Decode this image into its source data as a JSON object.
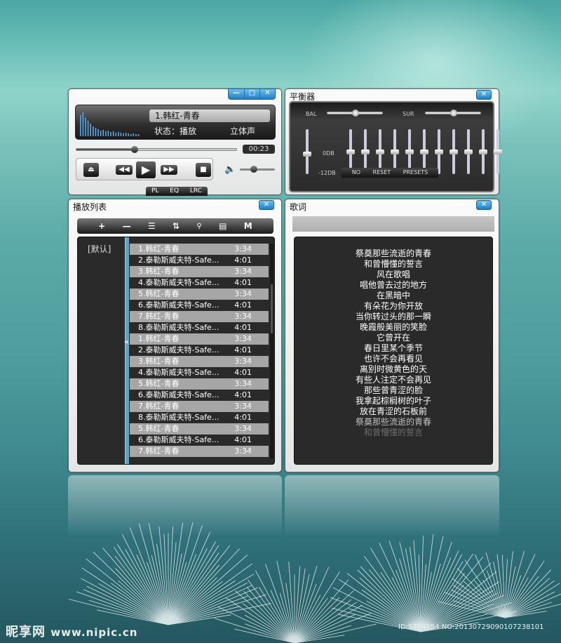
{
  "player": {
    "track": "1.韩红-青春",
    "status_label": "状态：",
    "status_value": "播放",
    "mode": "立体声",
    "time": "00:23",
    "progress": 0.36,
    "volume": 0.4,
    "tabs": [
      "PL",
      "EQ",
      "LRC"
    ],
    "window_buttons": [
      "—",
      "□",
      "✕"
    ]
  },
  "equalizer": {
    "title": "平衡器",
    "bal_label": "BAL",
    "sur_label": "SUR",
    "db_top": "0DB",
    "db_bottom": "-12DB",
    "bands": [
      0.5,
      0.5,
      0.5,
      0.5,
      0.5,
      0.5,
      0.5,
      0.5,
      0.5,
      0.5,
      0.5
    ],
    "preamp": 0.55,
    "buttons": [
      "NO",
      "RESET",
      "PRESETS"
    ]
  },
  "playlist": {
    "title": "播放列表",
    "category": "[默认]",
    "toolbar": [
      "+",
      "—",
      "☰",
      "⇅",
      "🔍",
      "▤",
      "M"
    ],
    "rows": [
      {
        "name": "1.韩红-青春",
        "dur": "3:34"
      },
      {
        "name": "2.泰勒斯威夫特-Safe...",
        "dur": "4:01"
      },
      {
        "name": "3.韩红-青春",
        "dur": "3:34"
      },
      {
        "name": "4.泰勒斯威夫特-Safe...",
        "dur": "4:01"
      },
      {
        "name": "5.韩红-青春",
        "dur": "3:34"
      },
      {
        "name": "6.泰勒斯威夫特-Safe...",
        "dur": "4:01"
      },
      {
        "name": "7.韩红-青春",
        "dur": "3:34"
      },
      {
        "name": "8.泰勒斯威夫特-Safe...",
        "dur": "4:01"
      },
      {
        "name": "1.韩红-青春",
        "dur": "3:34"
      },
      {
        "name": "2.泰勒斯威夫特-Safe...",
        "dur": "4:01"
      },
      {
        "name": "3.韩红-青春",
        "dur": "3:34"
      },
      {
        "name": "4.泰勒斯威夫特-Safe...",
        "dur": "4:01"
      },
      {
        "name": "5.韩红-青春",
        "dur": "3:34"
      },
      {
        "name": "6.泰勒斯威夫特-Safe...",
        "dur": "4:01"
      },
      {
        "name": "7.韩红-青春",
        "dur": "3:34"
      },
      {
        "name": "8.泰勒斯威夫特-Safe...",
        "dur": "4:01"
      },
      {
        "name": "5.韩红-青春",
        "dur": "3:34"
      },
      {
        "name": "6.泰勒斯威夫特-Safe...",
        "dur": "4:01"
      },
      {
        "name": "7.韩红-青春",
        "dur": "3:34"
      }
    ]
  },
  "lyrics": {
    "title": "歌词",
    "lines": [
      "祭奠那些流逝的青春",
      "和曾懵懂的誓言",
      "风在歌唱",
      "唱他曾去过的地方",
      "在黑暗中",
      "有朵花为你开放",
      "当你转过头的那一瞬",
      "晚霞般美丽的笑脸",
      "它曾开在",
      "春日里某个季节",
      "也许不会再看见",
      "离别时微黄色的天",
      "有些人注定不会再见",
      "那些曾青涩的脸",
      "我拿起棕榈树的叶子",
      "放在青涩的石板前",
      "祭奠那些流逝的青春",
      "和曾懵懂的誓言"
    ]
  },
  "watermark": {
    "brand": "昵享网",
    "url": "www.nipic.cn",
    "id": "ID:5704554 NO:20130729090107238101"
  }
}
